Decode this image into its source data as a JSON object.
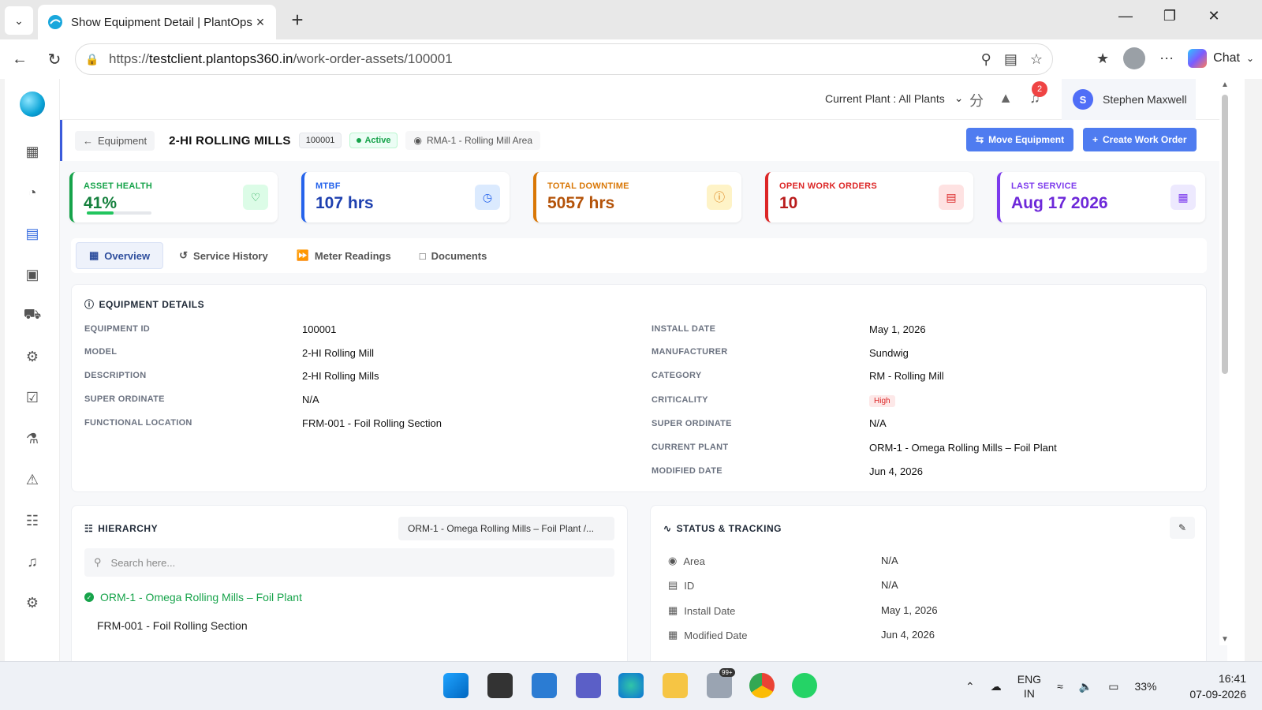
{
  "browser": {
    "tab_title": "Show Equipment Detail | PlantOps",
    "url_prefix": "https://",
    "url_host": "testclient.plantops360.in",
    "url_path": "/work-order-assets/100001",
    "chat_label": "Chat"
  },
  "topbar": {
    "plant_label": "Current Plant : All Plants",
    "notifications_count": "2",
    "user_initial": "S",
    "user_name": "Stephen Maxwell"
  },
  "header": {
    "back_label": "Equipment",
    "title": "2-HI ROLLING MILLS",
    "id": "100001",
    "status": "Active",
    "location": "RMA-1 - Rolling Mill Area",
    "move_label": "Move Equipment",
    "create_label": "Create Work Order"
  },
  "kpis": [
    {
      "label": "ASSET HEALTH",
      "value": "41%",
      "health_fraction": 0.41,
      "color": "#16a34a"
    },
    {
      "label": "MTBF",
      "value": "107 hrs",
      "color": "#2563eb"
    },
    {
      "label": "TOTAL DOWNTIME",
      "value": "5057 hrs",
      "color": "#d97706"
    },
    {
      "label": "OPEN WORK ORDERS",
      "value": "10",
      "color": "#dc2626"
    },
    {
      "label": "LAST SERVICE",
      "value": "Aug 17 2026",
      "color": "#7c3aed"
    }
  ],
  "tabs": [
    "Overview",
    "Service History",
    "Meter Readings",
    "Documents"
  ],
  "details": {
    "title": "EQUIPMENT DETAILS",
    "left": [
      {
        "label": "EQUIPMENT ID",
        "value": "100001"
      },
      {
        "label": "MODEL",
        "value": "2-HI Rolling Mill"
      },
      {
        "label": "DESCRIPTION",
        "value": "2-HI Rolling Mills"
      },
      {
        "label": "SUPER ORDINATE",
        "value": "N/A"
      },
      {
        "label": "FUNCTIONAL LOCATION",
        "value": "FRM-001 - Foil Rolling Section"
      }
    ],
    "right": [
      {
        "label": "INSTALL DATE",
        "value": "May 1, 2026"
      },
      {
        "label": "MANUFACTURER",
        "value": "Sundwig"
      },
      {
        "label": "CATEGORY",
        "value": "RM - Rolling Mill"
      },
      {
        "label": "CRITICALITY",
        "value": "High"
      },
      {
        "label": "SUPER ORDINATE",
        "value": "N/A"
      },
      {
        "label": "CURRENT PLANT",
        "value": "ORM-1 - Omega Rolling Mills – Foil Plant"
      },
      {
        "label": "MODIFIED DATE",
        "value": "Jun 4, 2026"
      }
    ]
  },
  "hierarchy": {
    "title": "HIERARCHY",
    "path": "ORM-1 - Omega Rolling Mills – Foil Plant /...",
    "search_placeholder": "Search here...",
    "root": "ORM-1 - Omega Rolling Mills – Foil Plant",
    "child": "FRM-001 - Foil Rolling Section"
  },
  "status": {
    "title": "STATUS & TRACKING",
    "rows": [
      {
        "label": "Area",
        "value": "N/A"
      },
      {
        "label": "ID",
        "value": "N/A"
      },
      {
        "label": "Install Date",
        "value": "May 1, 2026"
      },
      {
        "label": "Modified Date",
        "value": "Jun 4, 2026"
      }
    ]
  },
  "taskbar": {
    "lang1": "ENG",
    "lang2": "IN",
    "battery": "33%",
    "time": "16:41",
    "date": "07-09-2026",
    "mail_badge": "99+"
  }
}
